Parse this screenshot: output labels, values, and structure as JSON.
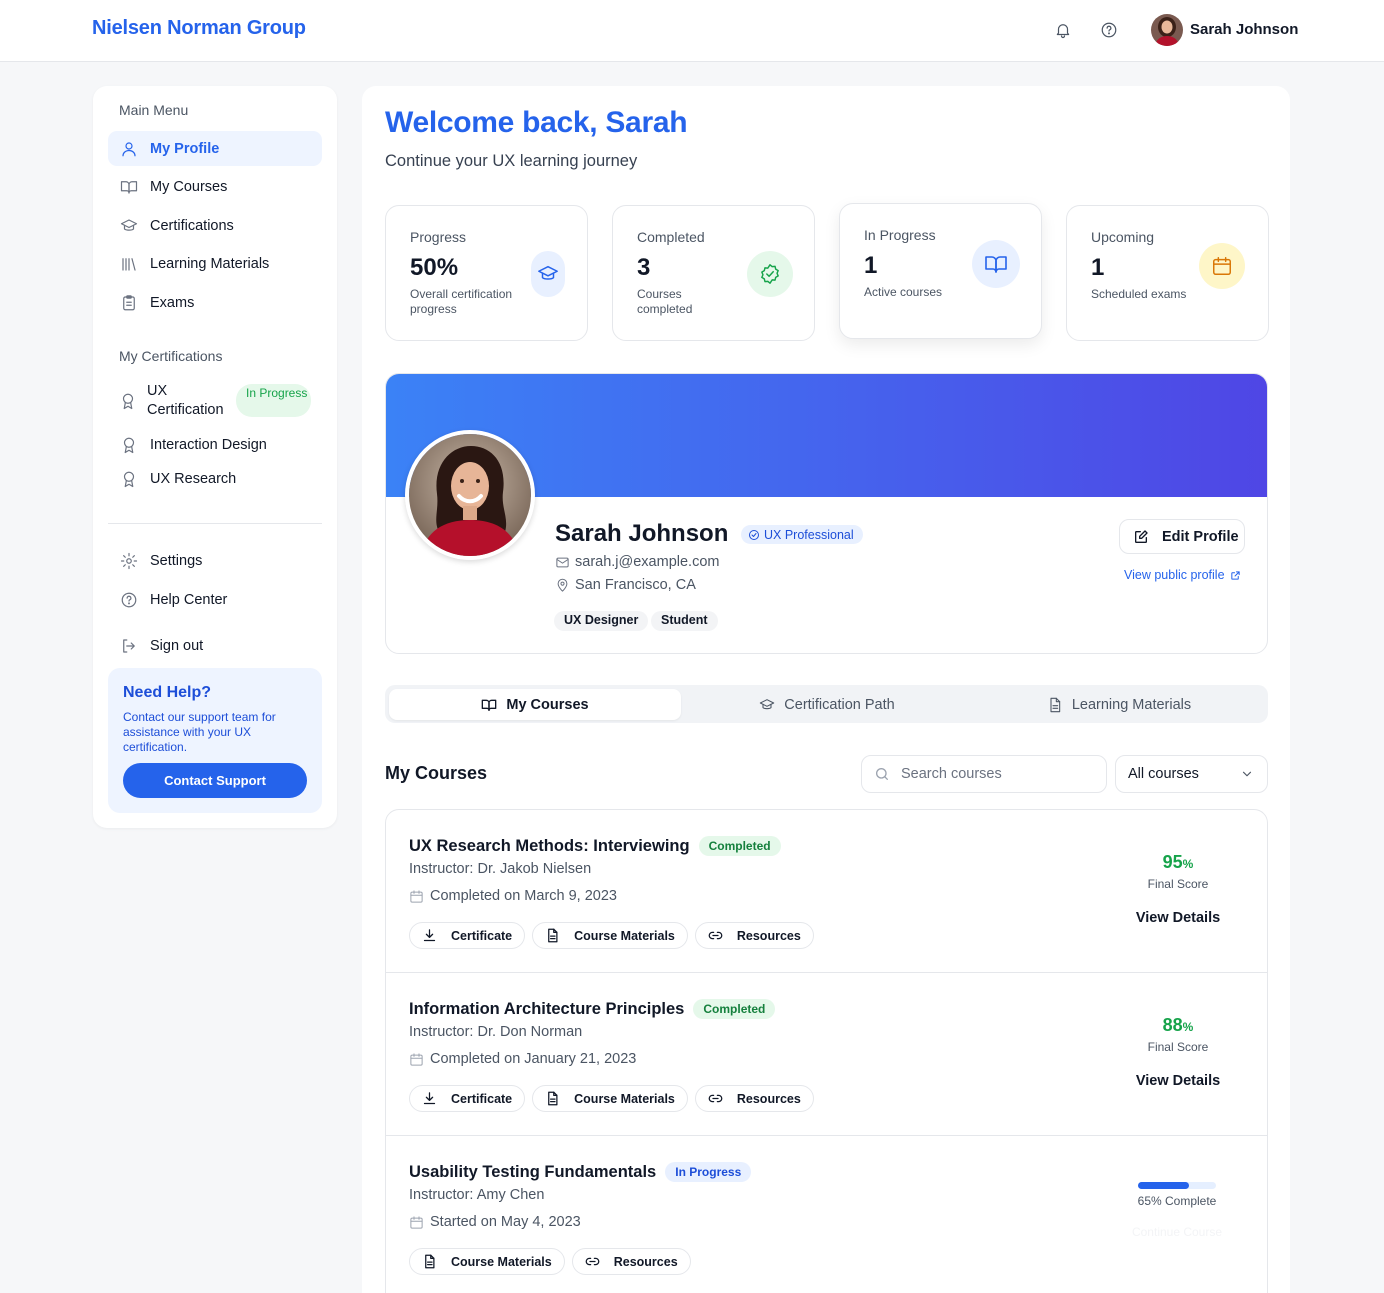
{
  "header": {
    "brand": "Nielsen Norman Group",
    "user_name": "Sarah Johnson"
  },
  "sidebar": {
    "main_menu_title": "Main Menu",
    "menu": [
      {
        "label": "My Profile",
        "icon": "user-icon",
        "active": true
      },
      {
        "label": "My Courses",
        "icon": "book-icon"
      },
      {
        "label": "Certifications",
        "icon": "graduation-cap-icon"
      },
      {
        "label": "Learning Materials",
        "icon": "library-icon"
      },
      {
        "label": "Exams",
        "icon": "clipboard-icon"
      }
    ],
    "certs_title": "My Certifications",
    "certs": [
      {
        "label": "UX Certification",
        "badge": "In Progress"
      },
      {
        "label": "Interaction Design"
      },
      {
        "label": "UX Research"
      }
    ],
    "settings": "Settings",
    "help_center": "Help Center",
    "sign_out": "Sign out",
    "help_box": {
      "title": "Need Help?",
      "text": "Contact our support team for assistance with your UX certification.",
      "button": "Contact Support"
    }
  },
  "main": {
    "welcome": "Welcome back, Sarah",
    "subtitle": "Continue your UX learning journey",
    "stats": [
      {
        "title": "Progress",
        "value": "50%",
        "desc": "Overall certification progress",
        "icon": "graduation-cap-icon",
        "color": "#2563eb"
      },
      {
        "title": "Completed",
        "value": "3",
        "desc": "Courses completed",
        "icon": "check-badge-icon",
        "color": "#16a34a"
      },
      {
        "title": "In Progress",
        "value": "1",
        "desc": "Active courses",
        "icon": "book-icon",
        "color": "#2563eb"
      },
      {
        "title": "Upcoming",
        "value": "1",
        "desc": "Scheduled exams",
        "icon": "calendar-icon",
        "color": "#d97706"
      }
    ]
  },
  "profile": {
    "name": "Sarah Johnson",
    "badge": "UX Professional",
    "email": "sarah.j@example.com",
    "location": "San Francisco, CA",
    "tags": [
      "UX Designer",
      "Student"
    ],
    "edit_label": "Edit Profile",
    "public_link": "View public profile"
  },
  "tabs": [
    "My Courses",
    "Certification Path",
    "Learning Materials"
  ],
  "courses_section": {
    "title": "My Courses",
    "search_placeholder": "Search courses",
    "filter_value": "All courses"
  },
  "courses": [
    {
      "title": "UX Research Methods: Interviewing",
      "status": "Completed",
      "instructor": "Instructor: Dr. Jakob Nielsen",
      "date": "Completed on March 9, 2023",
      "score": "95",
      "score_unit": "%",
      "score_label": "Final Score",
      "details": "View Details"
    },
    {
      "title": "Information Architecture Principles",
      "status": "Completed",
      "instructor": "Instructor: Dr. Don Norman",
      "date": "Completed on January 21, 2023",
      "score": "88",
      "score_unit": "%",
      "score_label": "Final Score",
      "details": "View Details"
    },
    {
      "title": "Usability Testing Fundamentals",
      "status": "In Progress",
      "instructor": "Instructor: Amy Chen",
      "date": "Started on May 4, 2023",
      "progress": 0.65,
      "progress_label": "65% Complete",
      "continue": "Continue Course"
    }
  ],
  "buttons": {
    "certificate": "Certificate",
    "materials": "Course Materials",
    "resources": "Resources"
  }
}
